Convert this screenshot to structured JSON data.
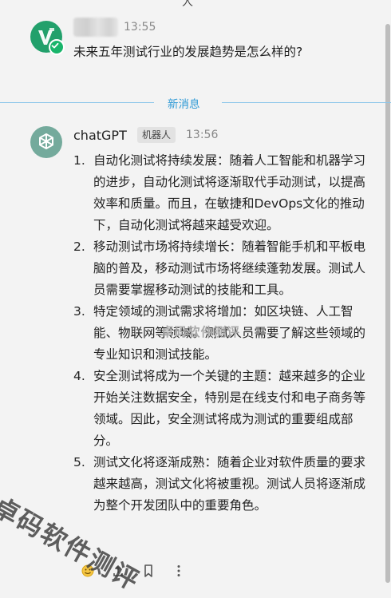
{
  "top_cut_text": "人",
  "user_message": {
    "time": "13:55",
    "text": "未来五年测试行业的发展趋势是怎么样的?"
  },
  "divider": {
    "label": "新消息"
  },
  "bot_message": {
    "name": "chatGPT",
    "badge": "机器人",
    "time": "13:56",
    "items": [
      {
        "num": "1.",
        "text": "自动化测试将持续发展：随着人工智能和机器学习的进步，自动化测试将逐渐取代手动测试，以提高效率和质量。而且，在敏捷和DevOps文化的推动下，自动化测试将越来越受欢迎。"
      },
      {
        "num": "2.",
        "text": "移动测试市场将持续增长：随着智能手机和平板电脑的普及，移动测试市场将继续蓬勃发展。测试人员需要掌握移动测试的技能和工具。"
      },
      {
        "num": "3.",
        "text": "特定领域的测试需求将增加：如区块链、人工智能、物联网等领域。测试人员需要了解这些领域的专业知识和测试技能。"
      },
      {
        "num": "4.",
        "text": "安全测试将成为一个关键的主题：越来越多的企业开始关注数据安全，特别是在线支付和电子商务等领域。因此，安全测试将成为测试的重要组成部分。"
      },
      {
        "num": "5.",
        "text": "测试文化将逐渐成熟：随着企业对软件质量的要求越来越高，测试文化将被重视。测试人员将逐渐成为整个开发团队中的重要角色。"
      }
    ]
  },
  "watermarks": {
    "center": "卓码软件测评",
    "big": "卓码软件测评"
  },
  "icons": {
    "user_avatar": "app-logo-icon",
    "online_badge": "check-badge-icon",
    "bot_avatar": "openai-logo-icon",
    "actions": [
      "emoji-react-icon",
      "share-icon",
      "bookmark-icon",
      "more-icon"
    ]
  },
  "colors": {
    "divider": "#2f9ad6",
    "bot_avatar": "#74aa9c",
    "user_avatar": "#22a06b"
  }
}
